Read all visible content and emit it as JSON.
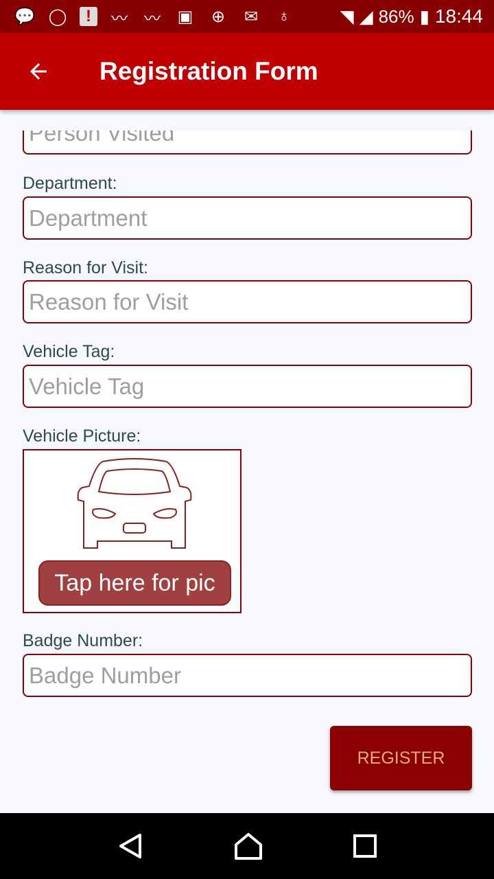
{
  "status_bar": {
    "battery": "86%",
    "time": "18:44",
    "icons": [
      "chat-icon",
      "whatsapp-icon",
      "alert-icon",
      "pulse-icon",
      "pulse-icon",
      "image-icon",
      "globe-icon",
      "gmail-icon",
      "bulb-icon",
      "wifi-icon",
      "signal-icon",
      "battery-charging-icon"
    ]
  },
  "app_bar": {
    "title": "Registration Form",
    "back_icon": "arrow-left-icon"
  },
  "form": {
    "person_visited": {
      "placeholder": "Person Visited"
    },
    "department": {
      "label": "Department:",
      "placeholder": "Department"
    },
    "reason": {
      "label": "Reason for Visit:",
      "placeholder": "Reason for Visit"
    },
    "vehicle_tag": {
      "label": "Vehicle Tag:",
      "placeholder": "Vehicle Tag"
    },
    "vehicle_picture": {
      "label": "Vehicle Picture:",
      "button": "Tap here for pic"
    },
    "badge": {
      "label": "Badge Number:",
      "placeholder": "Badge Number"
    },
    "register": "REGISTER"
  },
  "colors": {
    "primary": "#c00000",
    "dark": "#880000",
    "button_text": "#e8b070"
  }
}
